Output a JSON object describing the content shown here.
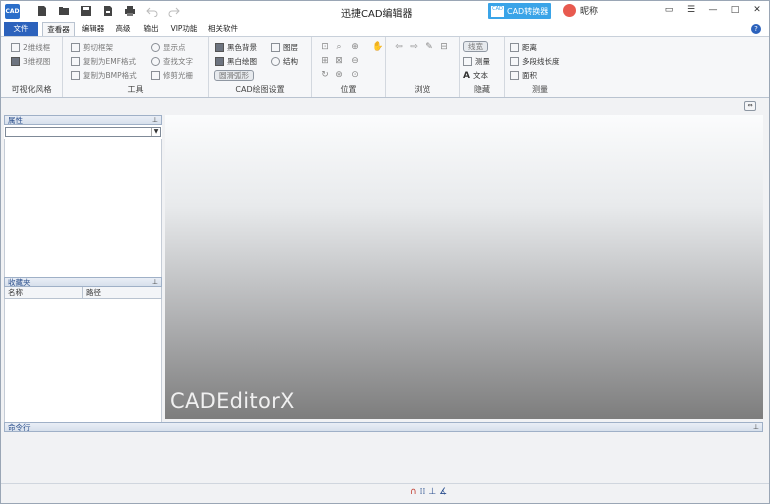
{
  "app": {
    "logo_text": "CAD",
    "title": "迅捷CAD编辑器",
    "converter_label": "CAD转换器",
    "converter_mini": "CAD",
    "nickname": "昵称"
  },
  "tabs": {
    "file": "文件",
    "items": [
      "查看器",
      "编辑器",
      "高级",
      "输出",
      "VIP功能",
      "相关软件"
    ]
  },
  "ribbon": {
    "visual_style": {
      "label": "可视化风格",
      "wireframe_2d": "2维线框",
      "view_3d": "3维视图"
    },
    "tools": {
      "label": "工具",
      "clip_frame": "剪切框架",
      "copy_emf": "复制为EMF格式",
      "copy_bmp": "复制为BMP格式",
      "show_points": "显示点",
      "find_text": "查找文字",
      "trim_raster": "修剪光栅"
    },
    "drawing_settings": {
      "label": "CAD绘图设置",
      "black_bg": "黑色背景",
      "bw_drawing": "黑白绘图",
      "smooth_arc": "圆滑弧形",
      "layers": "图层",
      "structure": "结构"
    },
    "position": {
      "label": "位置"
    },
    "browse": {
      "label": "浏览"
    },
    "hide": {
      "label": "隐藏",
      "linewidth": "线宽",
      "measure": "测量",
      "text": "文本"
    },
    "measure": {
      "label": "测量",
      "distance": "距离",
      "polyline_length": "多段线长度",
      "area": "面积"
    }
  },
  "panels": {
    "properties_title": "属性",
    "favorites_title": "收藏夹",
    "favorites_columns": [
      "名称",
      "路径"
    ],
    "command_title": "命令行"
  },
  "canvas": {
    "watermark": "CADEditorX"
  }
}
